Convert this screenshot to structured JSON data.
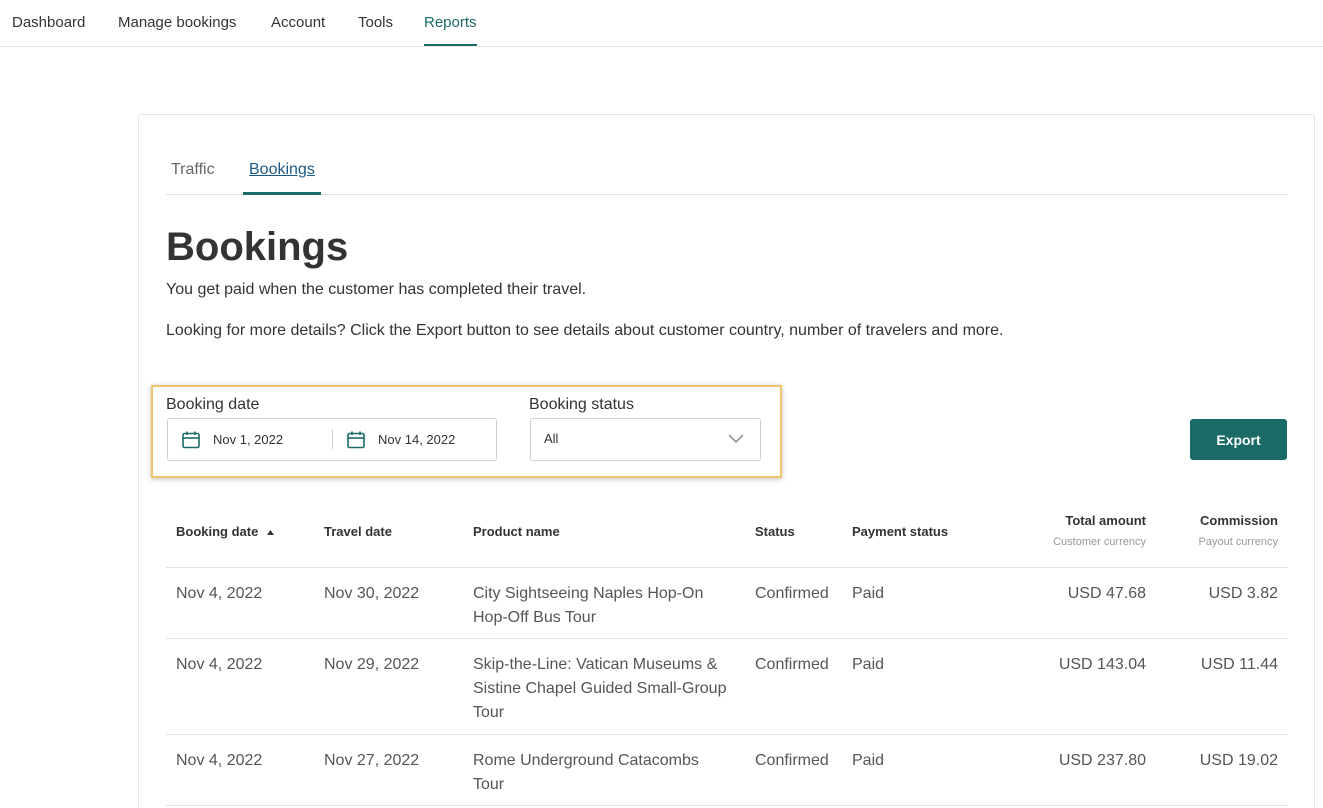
{
  "nav": {
    "items": [
      {
        "label": "Dashboard",
        "active": false
      },
      {
        "label": "Manage bookings",
        "active": false
      },
      {
        "label": "Account",
        "active": false
      },
      {
        "label": "Tools",
        "active": false
      },
      {
        "label": "Reports",
        "active": true
      }
    ]
  },
  "tabs": [
    {
      "label": "Traffic",
      "active": false
    },
    {
      "label": "Bookings",
      "active": true
    }
  ],
  "page": {
    "title": "Bookings",
    "description1": "You get paid when the customer has completed their travel.",
    "description2": "Looking for more details? Click the Export button to see details about customer country, number of travelers and more."
  },
  "filters": {
    "booking_date_label": "Booking date",
    "start_date": "Nov 1, 2022",
    "end_date": "Nov 14, 2022",
    "calendar_icon": "calendar-icon",
    "booking_status_label": "Booking status",
    "booking_status_value": "All"
  },
  "export_label": "Export",
  "table": {
    "headers": {
      "booking_date": "Booking date",
      "travel_date": "Travel date",
      "product_name": "Product name",
      "status": "Status",
      "payment_status": "Payment status",
      "total_amount": "Total amount",
      "total_amount_sub": "Customer currency",
      "commission": "Commission",
      "commission_sub": "Payout currency"
    },
    "rows": [
      {
        "booking_date": "Nov 4, 2022",
        "travel_date": "Nov 30, 2022",
        "product": "City Sightseeing Naples Hop-On Hop-Off Bus Tour",
        "status": "Confirmed",
        "payment": "Paid",
        "total": "USD 47.68",
        "commission": "USD 3.82"
      },
      {
        "booking_date": "Nov 4, 2022",
        "travel_date": "Nov 29, 2022",
        "product": "Skip-the-Line: Vatican Museums & Sistine Chapel Guided Small-Group Tour",
        "status": "Confirmed",
        "payment": "Paid",
        "total": "USD 143.04",
        "commission": "USD 11.44"
      },
      {
        "booking_date": "Nov 4, 2022",
        "travel_date": "Nov 27, 2022",
        "product": "Rome Underground Catacombs Tour",
        "status": "Confirmed",
        "payment": "Paid",
        "total": "USD 237.80",
        "commission": "USD 19.02"
      }
    ]
  },
  "colors": {
    "accent": "#1a6b67",
    "highlight": "#f0c36d"
  }
}
